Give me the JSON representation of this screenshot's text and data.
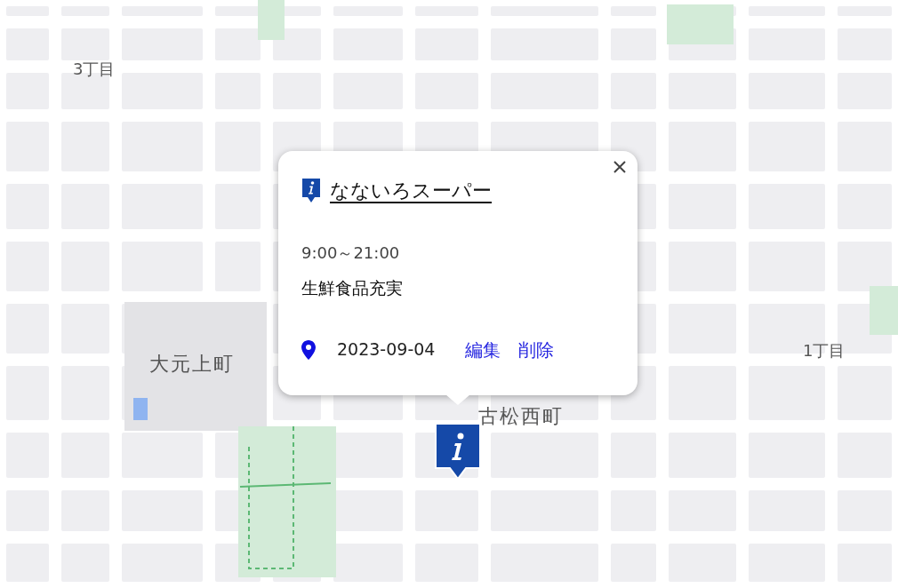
{
  "map": {
    "labels": [
      {
        "text": "3丁目"
      },
      {
        "text": "大元上町"
      },
      {
        "text": "1丁目"
      },
      {
        "text": "古松西町"
      }
    ]
  },
  "popup": {
    "title": "なないろスーパー",
    "hours": "9:00～21:00",
    "description": "生鮮食品充実",
    "date": "2023-09-04",
    "actions": [
      "編集",
      "削除"
    ]
  }
}
